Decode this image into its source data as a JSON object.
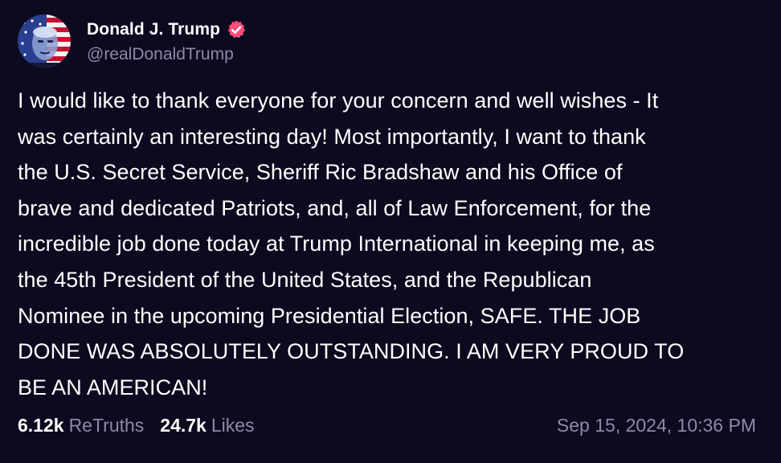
{
  "author": {
    "display_name": "Donald J. Trump",
    "handle": "@realDonaldTrump",
    "avatar_icon": "avatar-flag-portrait",
    "verified_icon": "verified-badge-icon",
    "verified_color": "#ff4d7a"
  },
  "post": {
    "text": "I would like to thank everyone for your concern and well wishes - It\nwas certainly an interesting day! Most importantly, I want to thank\nthe U.S. Secret Service, Sheriff Ric Bradshaw and his Office of\nbrave and dedicated Patriots, and, all of Law Enforcement, for the\nincredible job done today at Trump International in keeping me, as\nthe 45th President of the United States, and the Republican\nNominee in the upcoming Presidential Election, SAFE. THE JOB\nDONE WAS ABSOLUTELY OUTSTANDING. I AM VERY PROUD TO\nBE AN AMERICAN!"
  },
  "stats": {
    "retruths_count": "6.12k",
    "retruths_label": "ReTruths",
    "likes_count": "24.7k",
    "likes_label": "Likes"
  },
  "timestamp": "Sep 15, 2024, 10:36 PM",
  "colors": {
    "background": "#0c0a1f",
    "text_primary": "#ffffff",
    "text_secondary": "#8d8aa8"
  }
}
